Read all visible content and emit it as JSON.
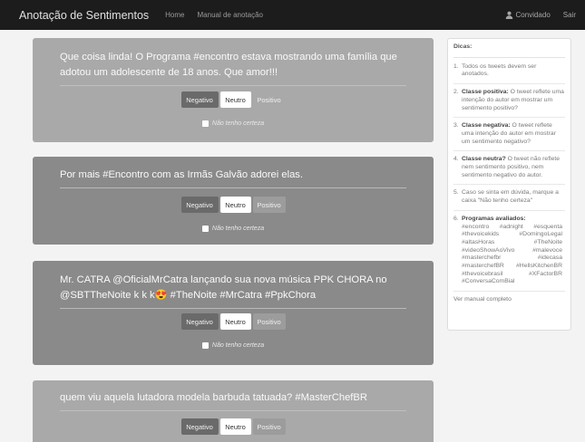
{
  "navbar": {
    "brand": "Anotação de Sentimentos",
    "links": [
      "Home",
      "Manual de anotação"
    ],
    "user": "Convidado",
    "logout": "Sair"
  },
  "buttons": {
    "negative": "Negativo",
    "neutral": "Neutro",
    "positive": "Positivo"
  },
  "unsure_label": "Não tenho certeza",
  "tweets": [
    {
      "text": "Que coisa linda! O Programa #encontro estava mostrando uma família que adotou um adolescente de 18 anos. Que amor!!!",
      "selected": "Neutro"
    },
    {
      "text": "Por mais #Encontro com as Irmãs Galvão adorei elas.",
      "selected": "Neutro"
    },
    {
      "text": "Mr. CATRA @OficialMrCatra lançando sua nova música PPK CHORA no @SBTTheNoite k k k😍 #TheNoite #MrCatra #PpkChora",
      "selected": "Neutro"
    },
    {
      "text": "quem viu aquela lutadora modela barbuda tatuada? #MasterChefBR",
      "selected": "Neutro"
    }
  ],
  "tips": {
    "title": "Dicas:",
    "items": [
      {
        "num": "1.",
        "bold": "",
        "text": "Todos os tweets devem ser anotados."
      },
      {
        "num": "2.",
        "bold": "Classe positiva:",
        "text": " O tweet reflete uma intenção do autor em mostrar um sentimento positivo?"
      },
      {
        "num": "3.",
        "bold": "Classe negativa:",
        "text": " O tweet reflete uma intenção do autor em mostrar um sentimento negativo?"
      },
      {
        "num": "4.",
        "bold": "Classe neutra?",
        "text": " O tweet não reflete nem sentimento positivo, nem sentimento negativo do autor."
      },
      {
        "num": "5.",
        "bold": "",
        "text": "Caso se sinta em dúvida, marque a caixa \"Não tenho certeza\""
      }
    ],
    "programs_num": "6.",
    "programs_title": "Programas avaliados:",
    "programs": [
      "#encontro",
      "#adnight",
      "#esquenta",
      "#thevoicekids",
      "#DomingoLegal",
      "#altasHoras",
      "#TheNoite",
      "#videoShowAoVivo",
      "#malevoce",
      "#masterchefbr",
      "#idecasa",
      "#masterchefBR",
      "#HellsKitchenBR",
      "#thevoicebrasil",
      "#XFactorBR",
      "#ConversaComBial"
    ],
    "manual_link": "Ver manual completo"
  }
}
